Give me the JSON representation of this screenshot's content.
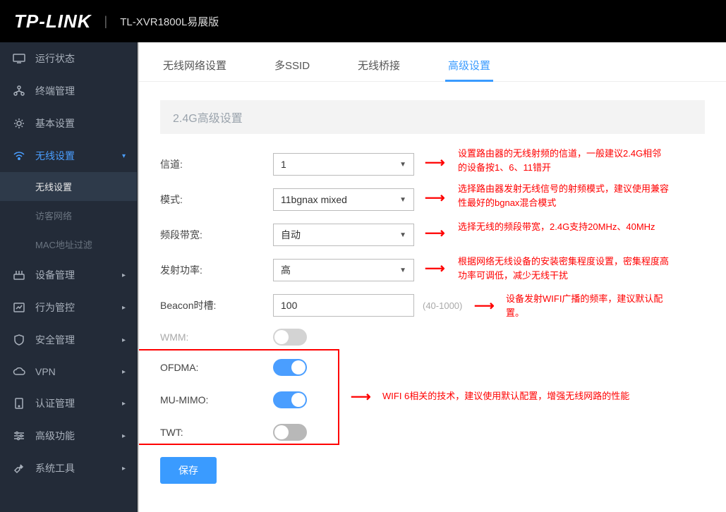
{
  "header": {
    "logo": "TP-LINK",
    "divider": "|",
    "model": "TL-XVR1800L易展版"
  },
  "sidebar": [
    {
      "icon": "monitor",
      "label": "运行状态",
      "state": ""
    },
    {
      "icon": "nodes",
      "label": "终端管理",
      "state": ""
    },
    {
      "icon": "gear",
      "label": "基本设置",
      "state": ""
    },
    {
      "icon": "wifi",
      "label": "无线设置",
      "state": "active",
      "arrow": "▾",
      "subs": [
        {
          "label": "无线设置",
          "cls": "active"
        },
        {
          "label": "访客网络",
          "cls": "dim"
        },
        {
          "label": "MAC地址过滤",
          "cls": "dim"
        }
      ]
    },
    {
      "icon": "device",
      "label": "设备管理",
      "state": "",
      "arrow": "▸"
    },
    {
      "icon": "behavior",
      "label": "行为管控",
      "state": "",
      "arrow": "▸"
    },
    {
      "icon": "shield",
      "label": "安全管理",
      "state": "",
      "arrow": "▸"
    },
    {
      "icon": "vpn",
      "label": "VPN",
      "state": "",
      "arrow": "▸"
    },
    {
      "icon": "auth",
      "label": "认证管理",
      "state": "",
      "arrow": "▸"
    },
    {
      "icon": "adv",
      "label": "高级功能",
      "state": "",
      "arrow": "▸"
    },
    {
      "icon": "tool",
      "label": "系统工具",
      "state": "",
      "arrow": "▸"
    }
  ],
  "tabs": [
    {
      "label": "无线网络设置",
      "active": false
    },
    {
      "label": "多SSID",
      "active": false
    },
    {
      "label": "无线桥接",
      "active": false
    },
    {
      "label": "高级设置",
      "active": true
    }
  ],
  "section_title": "2.4G高级设置",
  "form": {
    "channel": {
      "label": "信道:",
      "value": "1"
    },
    "mode": {
      "label": "模式:",
      "value": "11bgnax mixed"
    },
    "bandwidth": {
      "label": "频段带宽:",
      "value": "自动"
    },
    "txpower": {
      "label": "发射功率:",
      "value": "高"
    },
    "beacon": {
      "label": "Beacon时槽:",
      "value": "100",
      "hint": "(40-1000)"
    },
    "wmm": {
      "label": "WMM:",
      "on": false,
      "disabled": true
    },
    "ofdma": {
      "label": "OFDMA:",
      "on": true
    },
    "mumimo": {
      "label": "MU-MIMO:",
      "on": true
    },
    "twt": {
      "label": "TWT:",
      "on": false
    }
  },
  "notes": {
    "n1": "设置路由器的无线射频的信道，一般建议2.4G相邻的设备按1、6、11错开",
    "n2": "选择路由器发射无线信号的射频模式，建议使用兼容性最好的bgnax混合模式",
    "n3": "选择无线的频段带宽，2.4G支持20MHz、40MHz",
    "n4": "根据网络无线设备的安装密集程度设置，密集程度高功率可调低，减少无线干扰",
    "n5": "设备发射WIFI广播的频率，建议默认配置。",
    "n6": "WIFI 6相关的技术，建议使用默认配置，增强无线网路的性能"
  },
  "save": "保存"
}
